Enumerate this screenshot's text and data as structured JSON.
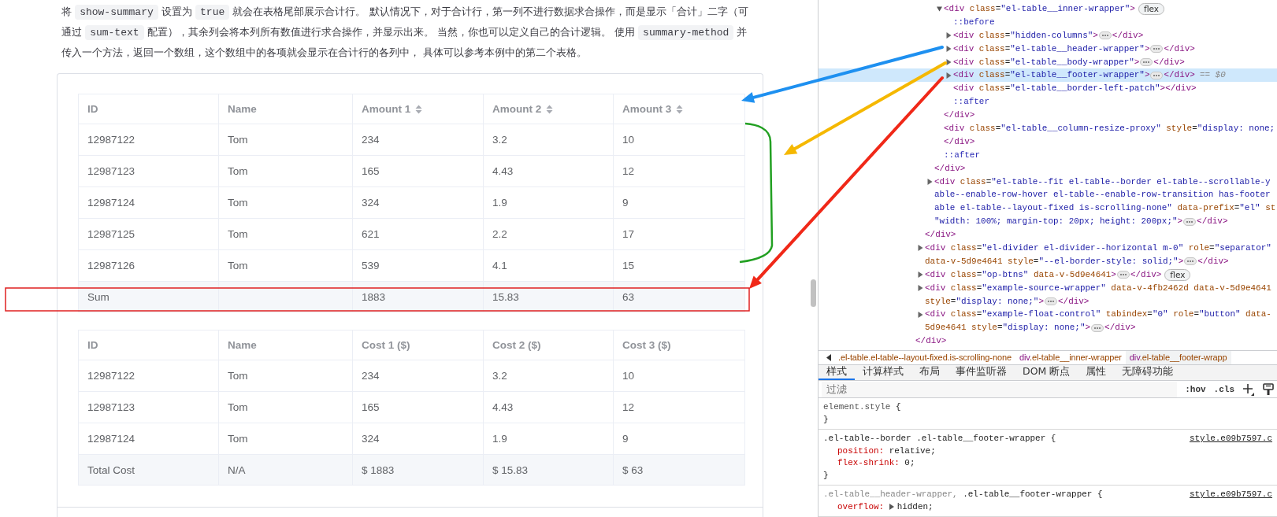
{
  "doc": {
    "paragraph": [
      {
        "kind": "text",
        "text": "将 "
      },
      {
        "kind": "code",
        "text": "show-summary"
      },
      {
        "kind": "text",
        "text": " 设置为 "
      },
      {
        "kind": "code",
        "text": "true"
      },
      {
        "kind": "text",
        "text": " 就会在表格尾部展示合计行。 默认情况下，对于合计行，第一列不进行数据求合操作，而是显示「合计」二字（可通过 "
      },
      {
        "kind": "code",
        "text": "sum-text"
      },
      {
        "kind": "text",
        "text": " 配置），其余列会将本列所有数值进行求合操作，并显示出来。 当然，你也可以定义自己的合计逻辑。 使用 "
      },
      {
        "kind": "code",
        "text": "summary-method"
      },
      {
        "kind": "text",
        "text": " 并传入一个方法，返回一个数组，这个数组中的各项就会显示在合计行的各列中， 具体可以参考本例中的第二个表格。"
      }
    ],
    "tables": [
      {
        "columns": [
          {
            "label": "ID",
            "sortable": false
          },
          {
            "label": "Name",
            "sortable": false
          },
          {
            "label": "Amount 1",
            "sortable": true
          },
          {
            "label": "Amount 2",
            "sortable": true
          },
          {
            "label": "Amount 3",
            "sortable": true
          }
        ],
        "rows": [
          [
            "12987122",
            "Tom",
            "234",
            "3.2",
            "10"
          ],
          [
            "12987123",
            "Tom",
            "165",
            "4.43",
            "12"
          ],
          [
            "12987124",
            "Tom",
            "324",
            "1.9",
            "9"
          ],
          [
            "12987125",
            "Tom",
            "621",
            "2.2",
            "17"
          ],
          [
            "12987126",
            "Tom",
            "539",
            "4.1",
            "15"
          ]
        ],
        "footer": [
          {
            "kind": "text",
            "text": "Sum"
          },
          {
            "kind": "blank"
          },
          {
            "kind": "text",
            "text": "1883"
          },
          {
            "kind": "text",
            "text": "15.83"
          },
          {
            "kind": "text",
            "text": "63"
          }
        ]
      },
      {
        "columns": [
          {
            "label": "ID",
            "sortable": false
          },
          {
            "label": "Name",
            "sortable": false
          },
          {
            "label": "Cost 1 ($)",
            "sortable": false
          },
          {
            "label": "Cost 2 ($)",
            "sortable": false
          },
          {
            "label": "Cost 3 ($)",
            "sortable": false
          }
        ],
        "rows": [
          [
            "12987122",
            "Tom",
            "234",
            "3.2",
            "10"
          ],
          [
            "12987123",
            "Tom",
            "165",
            "4.43",
            "12"
          ],
          [
            "12987124",
            "Tom",
            "324",
            "1.9",
            "9"
          ]
        ],
        "footer": [
          {
            "kind": "text",
            "text": "Total Cost"
          },
          {
            "kind": "text",
            "text": "N/A"
          },
          {
            "kind": "text",
            "text": "$ 1883"
          },
          {
            "kind": "text",
            "text": "$ 15.83"
          },
          {
            "kind": "text",
            "text": "$ 63"
          }
        ]
      }
    ]
  },
  "devtools": {
    "dom_tree": {
      "closing": "</div>",
      "children": [
        {
          "closing": "</div>",
          "children": [
            {
              "closing": "</div>",
              "children": [
                {
                  "kind": "element",
                  "lines": [
                    "<div class=\"el-table__inner-wrapper\">"
                  ],
                  "expanded": true,
                  "badge": "flex",
                  "selected": false,
                  "closing": "</div>",
                  "children": [
                    {
                      "kind": "pseudo",
                      "lines": [
                        "::before"
                      ]
                    },
                    {
                      "kind": "element",
                      "lines": [
                        "<div class=\"hidden-columns\">"
                      ],
                      "expanded": false,
                      "selected": false,
                      "closing": "</div>"
                    },
                    {
                      "kind": "element",
                      "lines": [
                        "<div class=\"el-table__header-wrapper\">"
                      ],
                      "expanded": false,
                      "selected": false,
                      "closing": "</div>"
                    },
                    {
                      "kind": "element",
                      "lines": [
                        "<div class=\"el-table__body-wrapper\">"
                      ],
                      "expanded": false,
                      "selected": false,
                      "closing": "</div>"
                    },
                    {
                      "kind": "element",
                      "lines": [
                        "<div class=\"el-table__footer-wrapper\">"
                      ],
                      "expanded": false,
                      "selected": true,
                      "closing": "</div>",
                      "suffix": "== $0"
                    },
                    {
                      "kind": "element",
                      "lines": [
                        "<div class=\"el-table__border-left-patch\"></div>"
                      ],
                      "selected": false
                    },
                    {
                      "kind": "pseudo",
                      "lines": [
                        "::after"
                      ]
                    }
                  ]
                },
                {
                  "kind": "element",
                  "lines": [
                    "<div class=\"el-table__column-resize-proxy\" style=\"display: none;"
                  ],
                  "selected": false,
                  "closing": "</div>"
                },
                {
                  "kind": "pseudo",
                  "lines": [
                    "::after"
                  ]
                }
              ]
            },
            {
              "kind": "element",
              "lines": [
                "<div class=\"el-table--fit el-table--border el-table--scrollable-y",
                "able--enable-row-hover el-table--enable-row-transition has-footer",
                "able el-table--layout-fixed is-scrolling-none\" data-prefix=\"el\" st",
                "\"width: 100%; margin-top: 20px; height: 200px;\">"
              ],
              "expanded": false,
              "selected": false,
              "closing": "</div>"
            }
          ]
        },
        {
          "kind": "element",
          "lines": [
            "<div class=\"el-divider el-divider--horizontal m-0\" role=\"separator\"",
            "data-v-5d9e4641 style=\"--el-border-style: solid;\">"
          ],
          "expanded": false,
          "selected": false,
          "closing": "</div>"
        },
        {
          "kind": "element",
          "lines": [
            "<div class=\"op-btns\" data-v-5d9e4641>"
          ],
          "expanded": false,
          "badge": "flex",
          "selected": false,
          "closing": "</div>"
        },
        {
          "kind": "element",
          "lines": [
            "<div class=\"example-source-wrapper\" data-v-4fb2462d data-v-5d9e4641",
            "style=\"display: none;\">"
          ],
          "expanded": false,
          "selected": false,
          "closing": "</div>"
        },
        {
          "kind": "element",
          "lines": [
            "<div class=\"example-float-control\" tabindex=\"0\" role=\"button\" data-",
            "5d9e4641 style=\"display: none;\">"
          ],
          "expanded": false,
          "selected": false,
          "closing": "</div>"
        }
      ]
    },
    "breadcrumbs": [
      {
        "text": ".el-table.el-table--layout-fixed.is-scrolling-none",
        "selected": false
      },
      {
        "text": "div.el-table__inner-wrapper",
        "selected": false
      },
      {
        "text": "div.el-table__footer-wrapp",
        "selected": true
      }
    ],
    "tabs": [
      {
        "label": "样式",
        "selected": true
      },
      {
        "label": "计算样式",
        "selected": false
      },
      {
        "label": "布局",
        "selected": false
      },
      {
        "label": "事件监听器",
        "selected": false
      },
      {
        "label": "DOM 断点",
        "selected": false
      },
      {
        "label": "属性",
        "selected": false
      },
      {
        "label": "无障碍功能",
        "selected": false
      }
    ],
    "filter": {
      "placeholder": "过滤",
      "buttons": [
        ":hov",
        ".cls"
      ]
    },
    "rules": [
      {
        "kind": "inline",
        "selectors": [
          {
            "text": "element.style",
            "matched": true
          }
        ],
        "open": "{",
        "close": "}"
      },
      {
        "kind": "rule",
        "selectors": [
          {
            "text": ".el-table--border .el-table__footer-wrapper",
            "matched": true
          }
        ],
        "open": "{",
        "source": "style.e09b7597.c",
        "declarations": [
          {
            "text": "position: relative;",
            "expandable": false
          },
          {
            "text": "flex-shrink: 0;",
            "expandable": false
          }
        ],
        "close": "}"
      },
      {
        "kind": "rule",
        "selectors": [
          {
            "text": ".el-table__header-wrapper,",
            "matched": false
          },
          {
            "text": ".el-table__footer-wrapper",
            "matched": true
          }
        ],
        "open": "{",
        "source": "style.e09b7597.c",
        "declarations": [
          {
            "text": "overflow: hidden;",
            "expandable": true
          }
        ]
      }
    ]
  }
}
